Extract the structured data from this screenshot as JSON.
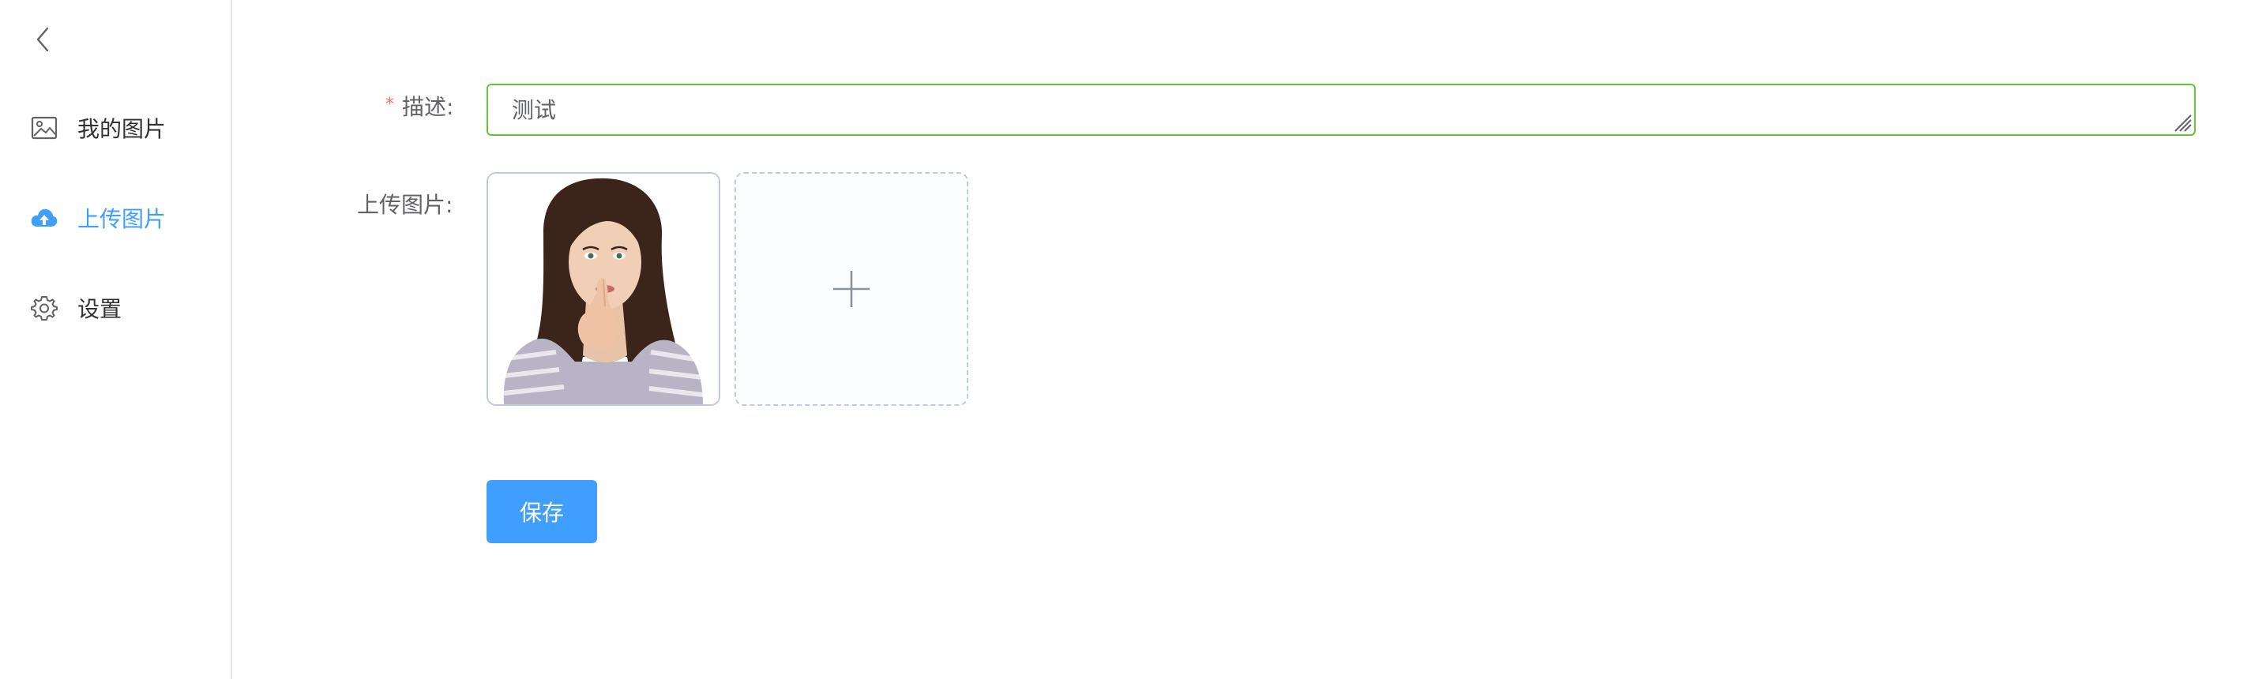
{
  "sidebar": {
    "collapse_icon": "chevron-left-icon",
    "items": [
      {
        "label": "我的图片",
        "icon": "picture-icon",
        "active": false
      },
      {
        "label": "上传图片",
        "icon": "upload-cloud-icon",
        "active": true
      },
      {
        "label": "设置",
        "icon": "gear-icon",
        "active": false
      }
    ]
  },
  "form": {
    "description": {
      "label": "描述:",
      "required": "*",
      "value": "测试"
    },
    "upload": {
      "label": "上传图片:",
      "uploaded_status": "success",
      "add_icon": "plus-icon"
    },
    "save_label": "保存"
  },
  "colors": {
    "accent": "#409eff",
    "success": "#13ce66",
    "input_border": "#67c23a",
    "required": "#f56c6c"
  }
}
